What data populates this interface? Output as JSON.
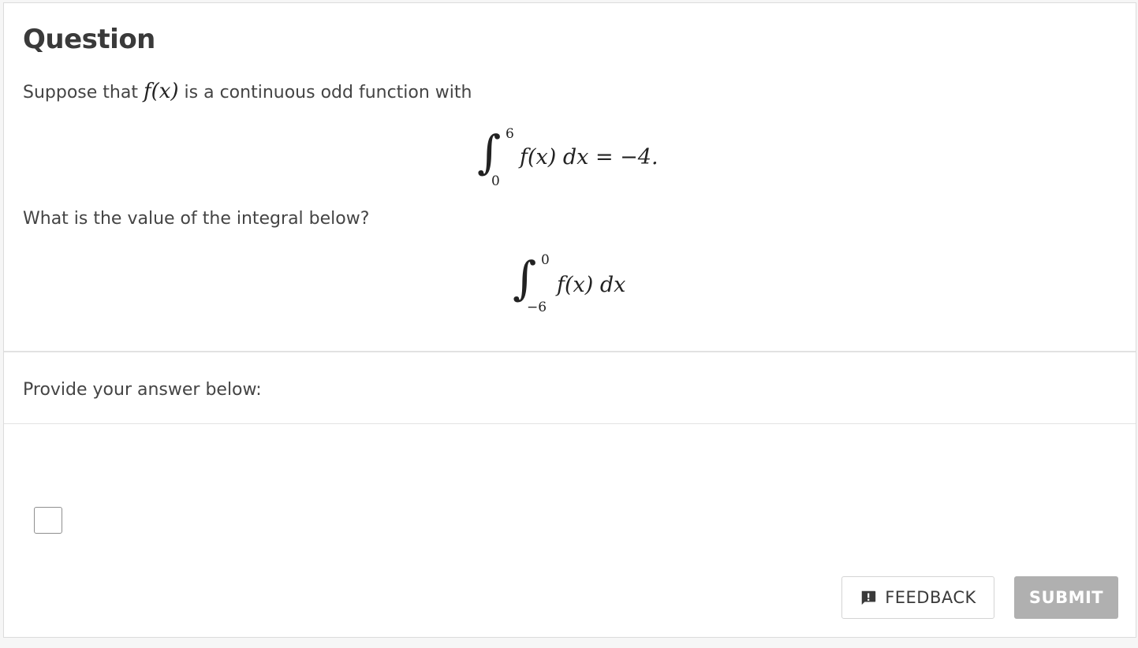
{
  "question": {
    "title": "Question",
    "intro_before": "Suppose that ",
    "intro_math": "f(x)",
    "intro_after": " is a continuous odd function with",
    "integral1": {
      "upper": "6",
      "lower": "0",
      "expression": "f(x) dx = −4."
    },
    "prompt": "What is the value of the integral below?",
    "integral2": {
      "upper": "0",
      "lower": "−6",
      "expression": "f(x) dx"
    }
  },
  "answer": {
    "label": "Provide your answer below:",
    "value": ""
  },
  "buttons": {
    "feedback_label": "FEEDBACK",
    "feedback_icon": "feedback-exclamation-icon",
    "submit_label": "SUBMIT"
  },
  "colors": {
    "submit_disabled": "#b0b0b0",
    "text": "#444444",
    "divider": "#e2e2e2"
  }
}
